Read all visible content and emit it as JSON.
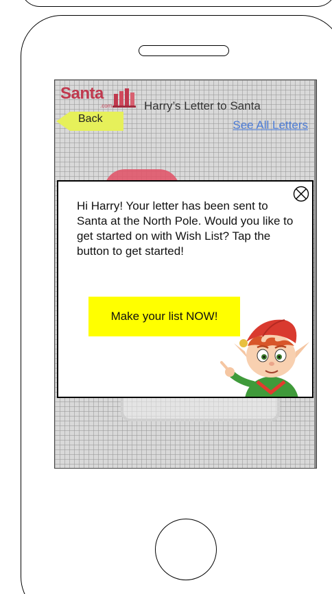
{
  "app": {
    "logo_text": "Santa",
    "logo_sub": ".com",
    "page_title": "Harry’s Letter to Santa"
  },
  "nav": {
    "back_label": "Back",
    "see_all_label": "See All Letters"
  },
  "modal": {
    "message": "Hi Harry! Your letter has been sent to Santa at the North Pole. Would you like to get started on with Wish List? Tap the button to get started!",
    "cta_label": "Make your list NOW!"
  },
  "colors": {
    "cta_background": "#ffff00",
    "back_arrow": "#e6f05a",
    "link": "#4b7bd6",
    "logo": "#c0394e"
  },
  "icons": {
    "close": "close-circle-x-icon",
    "logo": "santa-book-icon",
    "back": "back-arrow-icon",
    "mascot": "elf-illustration"
  }
}
